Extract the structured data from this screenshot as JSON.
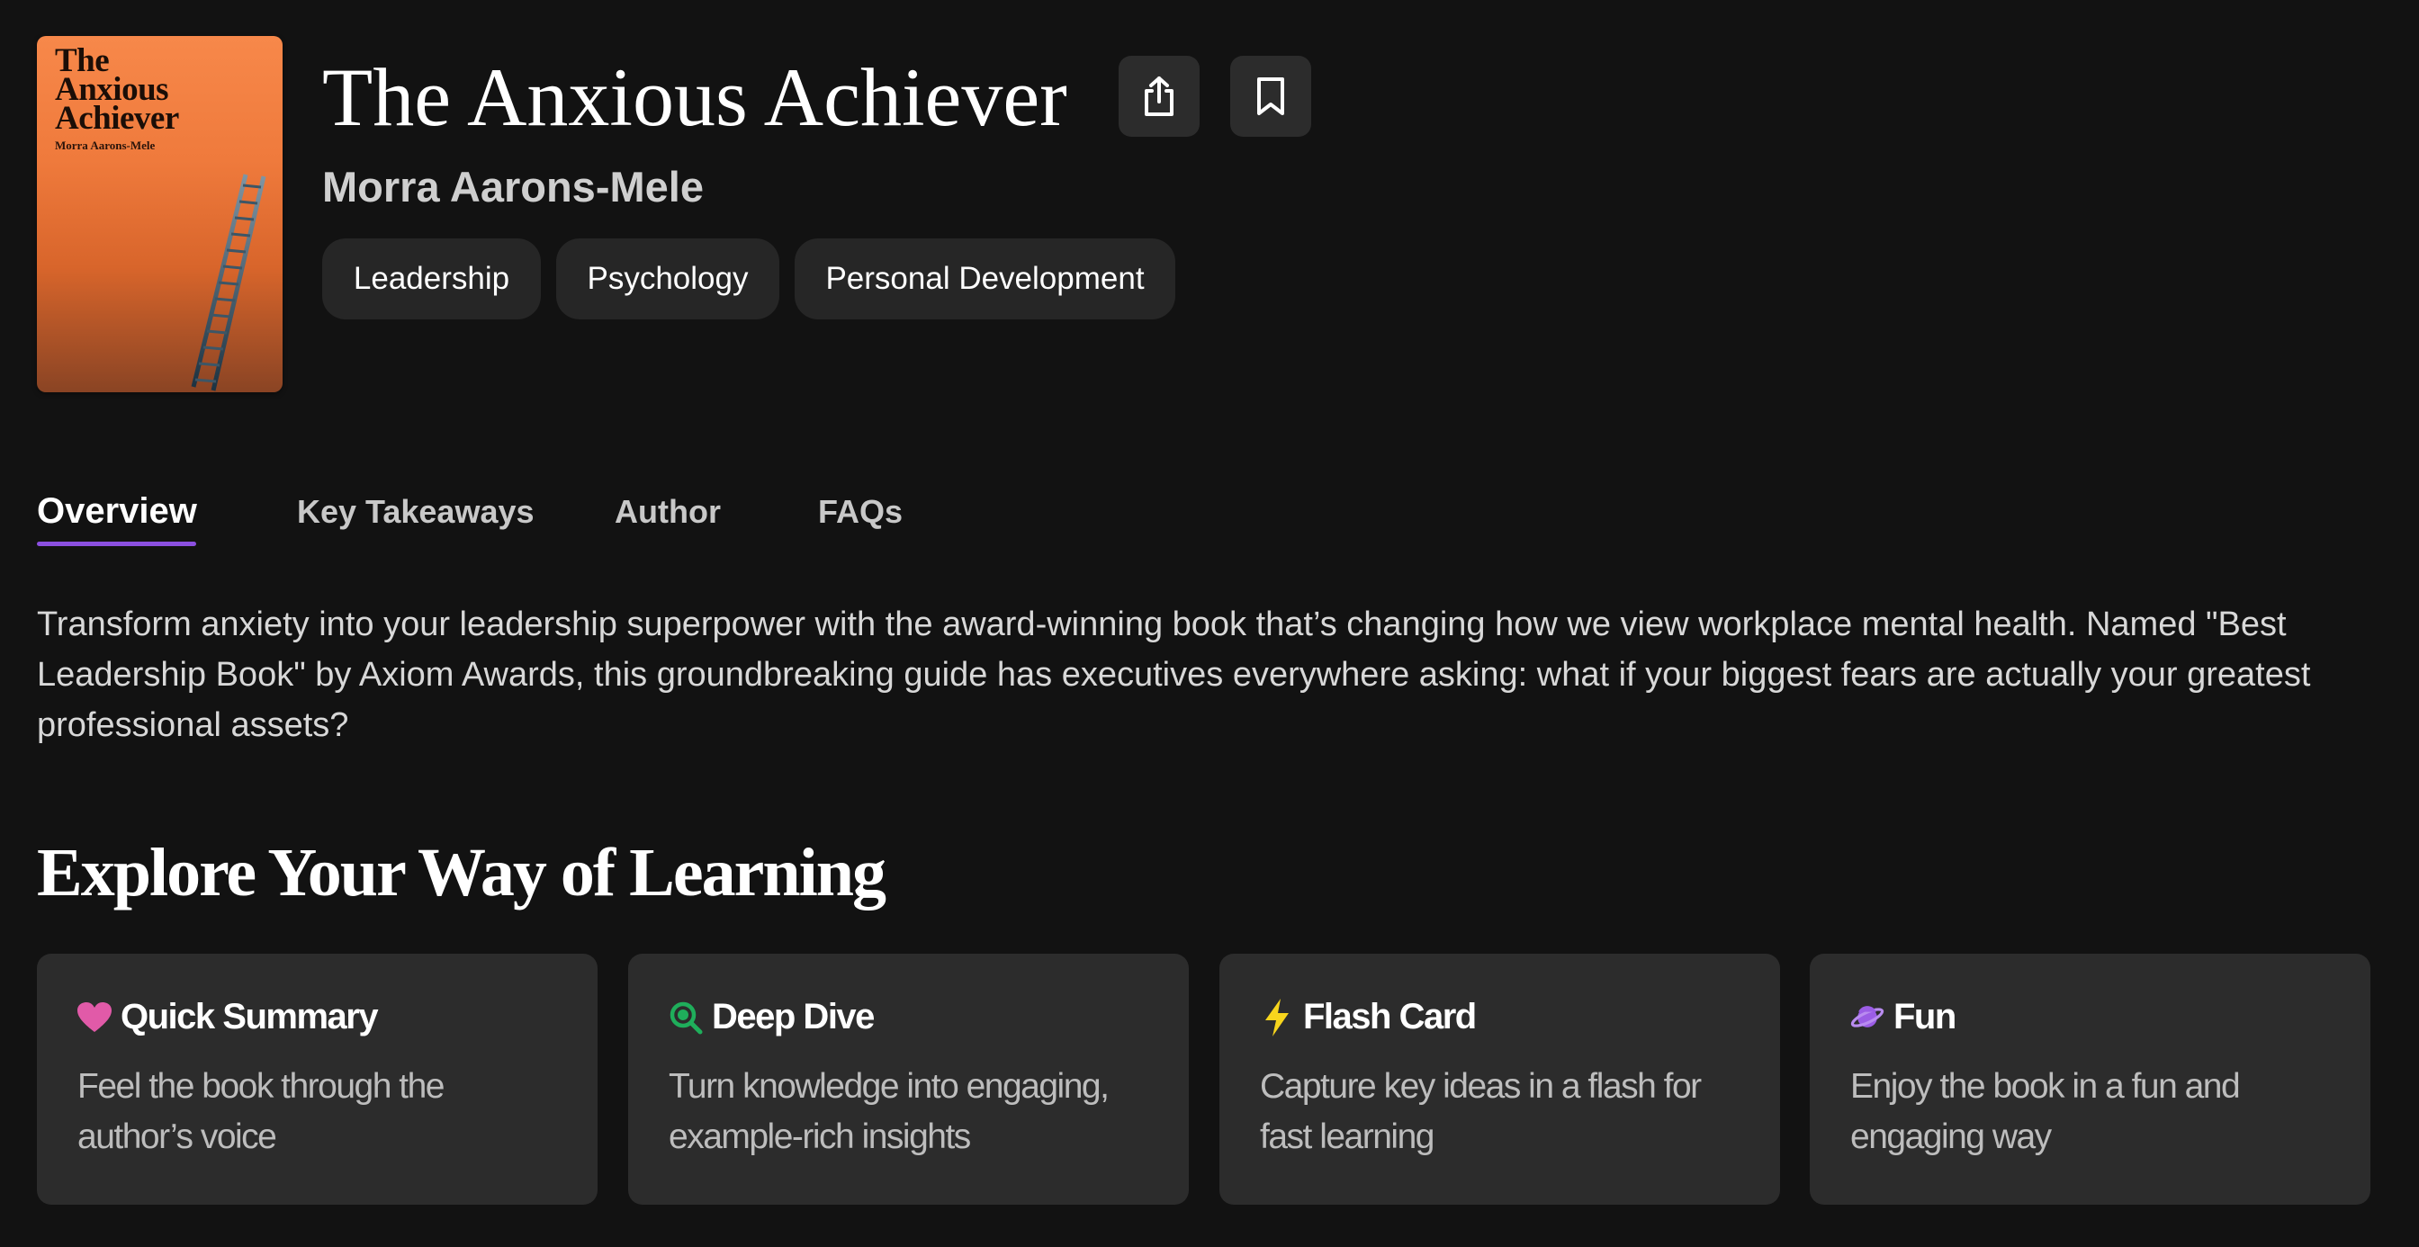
{
  "book": {
    "cover_title": "The Anxious Achiever",
    "cover_author": "Morra Aarons-Mele",
    "title": "The Anxious Achiever",
    "author": "Morra Aarons-Mele",
    "tags": [
      "Leadership",
      "Psychology",
      "Personal Development"
    ]
  },
  "actions": {
    "share_icon": "share-icon",
    "bookmark_icon": "bookmark-icon"
  },
  "tabs": [
    {
      "label": "Overview",
      "active": true
    },
    {
      "label": "Key Takeaways",
      "active": false
    },
    {
      "label": "Author",
      "active": false
    },
    {
      "label": "FAQs",
      "active": false
    }
  ],
  "overview": {
    "description": "Transform anxiety into your leadership superpower with the award-winning book that’s changing how we view workplace mental health. Named \"Best Leadership Book\" by Axiom Awards, this groundbreaking guide has executives everywhere asking: what if your biggest fears are actually your greatest professional assets?"
  },
  "learning": {
    "title": "Explore Your Way of Learning",
    "cards": [
      {
        "icon": "heart-icon",
        "icon_color": "#e15aa8",
        "title": "Quick Summary",
        "text": "Feel the book through the author’s voice"
      },
      {
        "icon": "magnifier-icon",
        "icon_color": "#1fae5b",
        "title": "Deep Dive",
        "text": "Turn knowledge into engaging, example-rich insights"
      },
      {
        "icon": "lightning-icon",
        "icon_color": "#f7d51d",
        "title": "Flash Card",
        "text": "Capture key ideas in a flash for fast learning"
      },
      {
        "icon": "planet-icon",
        "icon_color": "#9b5de5",
        "title": "Fun",
        "text": "Enjoy the book in a fun and engaging way"
      }
    ]
  },
  "colors": {
    "background": "#121212",
    "card": "#2c2c2c",
    "accent": "#8b4fe0",
    "cover": "#ef7a3c"
  }
}
